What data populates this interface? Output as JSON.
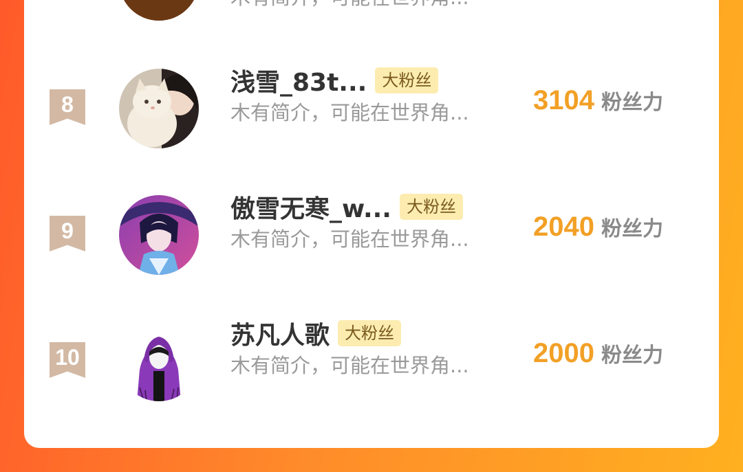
{
  "colors": {
    "score": "#f2a026",
    "badge_bg": "#fcecb0",
    "rank_bg": "#d3b9a4",
    "background_left": "#ff5a2a",
    "background_right": "#ffb020"
  },
  "partial_row": {
    "desc": "木有简介，可能在世界角..."
  },
  "fans": [
    {
      "rank": "8",
      "name": "浅雪_83t...",
      "badge": "大粉丝",
      "desc": "木有简介，可能在世界角...",
      "score": "3104",
      "unit": "粉丝力",
      "avatar_icon": "kitten-and-girl-photo"
    },
    {
      "rank": "9",
      "name": "傲雪无寒_w...",
      "badge": "大粉丝",
      "desc": "木有简介，可能在世界角...",
      "score": "2040",
      "unit": "粉丝力",
      "avatar_icon": "anime-boy-umbrella-illustration"
    },
    {
      "rank": "10",
      "name": "苏凡人歌",
      "badge": "大粉丝",
      "desc": "木有简介，可能在世界角...",
      "score": "2000",
      "unit": "粉丝力",
      "avatar_icon": "purple-hoodie-character-illustration"
    }
  ]
}
